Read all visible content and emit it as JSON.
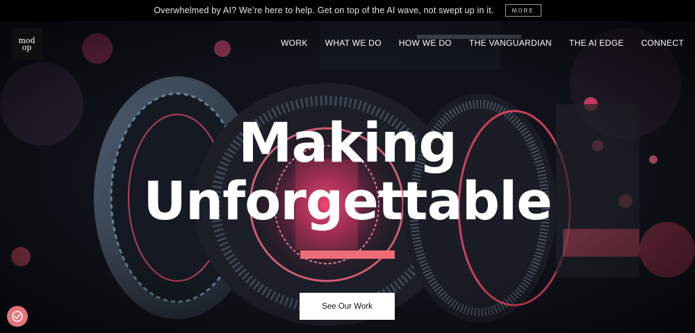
{
  "announcement": {
    "text": "Overwhelmed by AI? We’re here to help. Get on top of the AI wave, not swept up in it.",
    "button_label": "MORE"
  },
  "logo": {
    "line1": "mod",
    "line2": "op"
  },
  "nav": {
    "items": [
      {
        "label": "WORK"
      },
      {
        "label": "WHAT WE DO"
      },
      {
        "label": "HOW WE DO"
      },
      {
        "label": "THE VANGUARDIAN"
      },
      {
        "label": "THE AI EDGE"
      },
      {
        "label": "CONNECT"
      }
    ]
  },
  "hero": {
    "headline_line1": "Making",
    "headline_line2": "Unforgettable",
    "cta_label": "See Our Work",
    "accent_color": "#ee6b78"
  },
  "cookie_button": {
    "icon": "cookie-settings-icon"
  }
}
